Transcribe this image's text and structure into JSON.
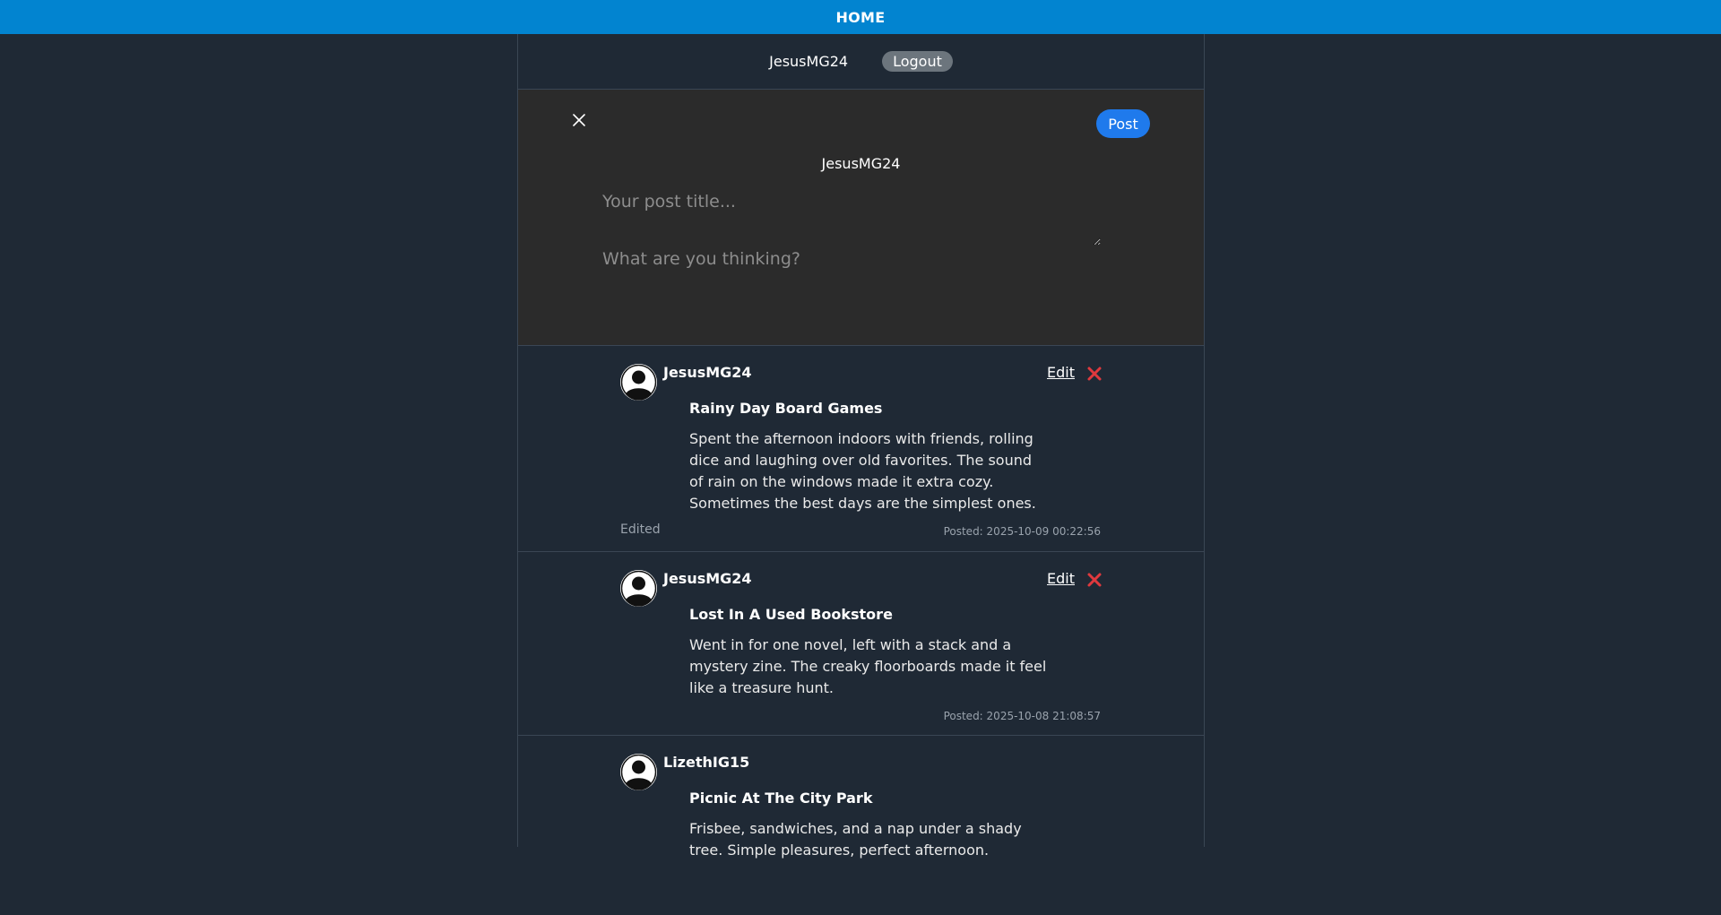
{
  "nav": {
    "home_label": "HOME"
  },
  "userbar": {
    "username": "JesusMG24",
    "logout_label": "Logout"
  },
  "composer": {
    "post_label": "Post",
    "author": "JesusMG24",
    "title_placeholder": "Your post title...",
    "body_placeholder": "What are you thinking?",
    "close_icon": "close-icon"
  },
  "posts": [
    {
      "author": "JesusMG24",
      "edit_label": "Edit",
      "title": "Rainy Day Board Games",
      "body": "Spent the afternoon indoors with friends, rolling dice and laughing over old favorites. The sound of rain on the windows made it extra cozy. Sometimes the best days are the simplest ones.",
      "edited_label": "Edited",
      "date": "Posted: 2025-10-09 00:22:56"
    },
    {
      "author": "JesusMG24",
      "edit_label": "Edit",
      "title": "Lost In A Used Bookstore",
      "body": "Went in for one novel, left with a stack and a mystery zine. The creaky floorboards made it feel like a treasure hunt.",
      "date": "Posted: 2025-10-08 21:08:57"
    },
    {
      "author": "LizethIG15",
      "title": "Picnic At The City Park",
      "body": "Frisbee, sandwiches, and a nap under a shady tree. Simple pleasures, perfect afternoon."
    }
  ],
  "colors": {
    "topbar": "#0284d0",
    "background": "#1f2935",
    "composer_bg": "#2b2b2b",
    "post_button": "#1f7aec",
    "delete_icon": "#e0393e",
    "logout_button": "#6c757d"
  }
}
